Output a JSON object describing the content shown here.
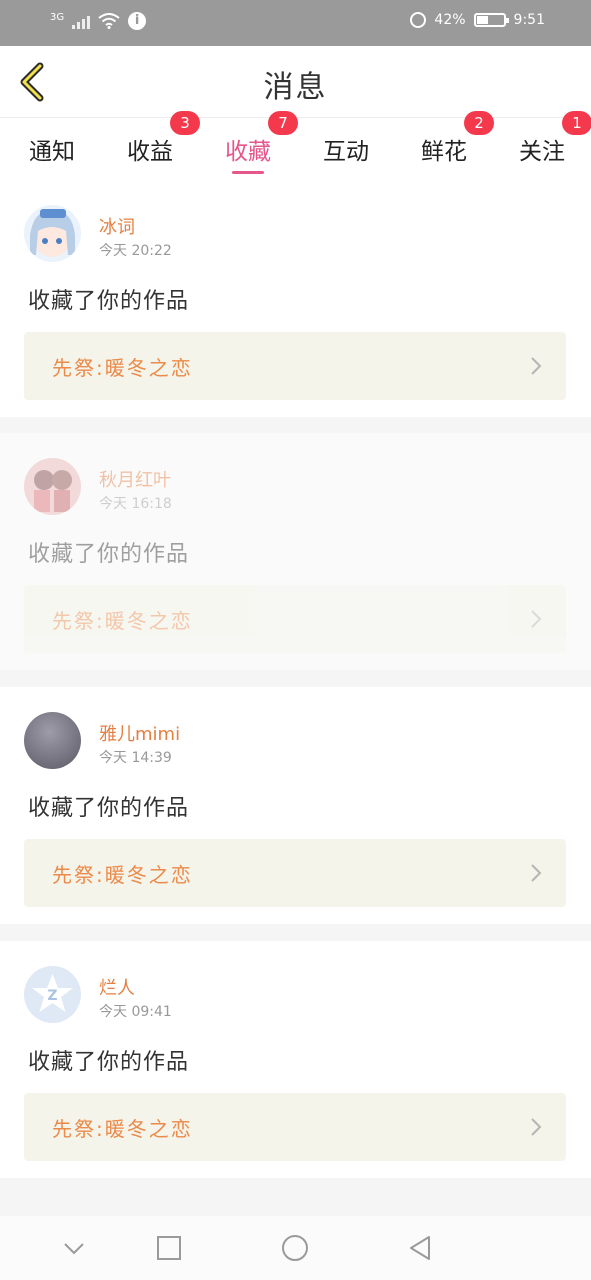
{
  "statusbar": {
    "signal_label": "3G",
    "battery_text": "42%",
    "battery_level": 0.42,
    "time": "9:51",
    "icons": [
      "signal-icon",
      "wifi-icon",
      "info-icon",
      "alarm-icon",
      "battery-icon"
    ]
  },
  "header": {
    "title": "消息",
    "back_icon": "chevron-left-icon"
  },
  "tabs": [
    {
      "label": "通知",
      "badge": ""
    },
    {
      "label": "收益",
      "badge": "3"
    },
    {
      "label": "收藏",
      "badge": "7",
      "active": true
    },
    {
      "label": "互动",
      "badge": ""
    },
    {
      "label": "鲜花",
      "badge": "2"
    },
    {
      "label": "关注",
      "badge": "1"
    }
  ],
  "messages": [
    {
      "name": "冰词",
      "time": "今天  20:22",
      "text": "收藏了你的作品",
      "work_title": "先祭:暖冬之恋"
    },
    {
      "name": "秋月红叶",
      "time": "今天  16:18",
      "text": "收藏了你的作品",
      "work_title": "先祭:暖冬之恋"
    },
    {
      "name": "雅儿mimi",
      "time": "今天  14:39",
      "text": "收藏了你的作品",
      "work_title": "先祭:暖冬之恋"
    },
    {
      "name": "烂人",
      "time": "今天  09:41",
      "text": "收藏了你的作品",
      "work_title": "先祭:暖冬之恋"
    }
  ],
  "colors": {
    "accent": "#e5568b",
    "badge": "#f4394c",
    "name": "#e47f40",
    "work_title": "#eb8a49",
    "work_bg": "#f5f4ea"
  },
  "navbar": {
    "icons": [
      "chevron-down-icon",
      "square-icon",
      "circle-icon",
      "triangle-back-icon"
    ]
  }
}
